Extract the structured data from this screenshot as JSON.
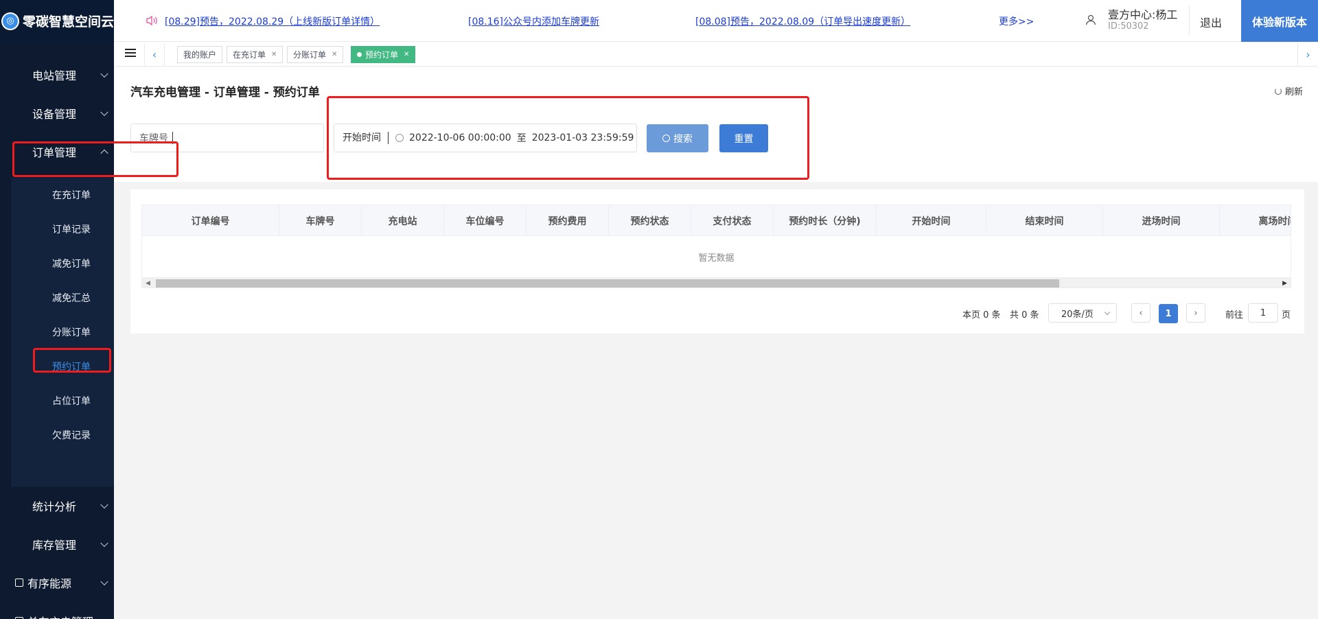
{
  "header": {
    "logo_text": "零碳智慧空间云",
    "notices": [
      "[08.29]预告，2022.08.29（上线新版订单详情）",
      "[08.16]公众号内添加车牌更新",
      "[08.08]预告，2022.08.09（订单导出速度更新）"
    ],
    "more": "更多>>",
    "user_name": "壹方中心:杨工",
    "user_id": "ID:50302",
    "logout": "退出",
    "new_version": "体验新版本"
  },
  "sidebar": {
    "items": [
      {
        "label": "电站管理"
      },
      {
        "label": "设备管理"
      },
      {
        "label": "订单管理"
      },
      {
        "label": "统计分析"
      },
      {
        "label": "库存管理"
      },
      {
        "label": "有序能源"
      },
      {
        "label": "单车充电管理"
      }
    ],
    "submenu": [
      {
        "label": "在充订单"
      },
      {
        "label": "订单记录"
      },
      {
        "label": "减免订单"
      },
      {
        "label": "减免汇总"
      },
      {
        "label": "分账订单"
      },
      {
        "label": "预约订单"
      },
      {
        "label": "占位订单"
      },
      {
        "label": "欠费记录"
      }
    ],
    "active_submenu": "预约订单"
  },
  "tabs": [
    {
      "label": "我的账户"
    },
    {
      "label": "在充订单"
    },
    {
      "label": "分账订单"
    },
    {
      "label": "预约订单"
    }
  ],
  "page": {
    "title": "汽车充电管理 - 订单管理 - 预约订单",
    "refresh": "刷新",
    "plate_placeholder": "车牌号",
    "start_time_label": "开始时间",
    "date_start": "2022-10-06 00:00:00",
    "date_sep": "至",
    "date_end": "2023-01-03 23:59:59",
    "search": "搜索",
    "reset": "重置"
  },
  "table": {
    "columns": [
      "订单编号",
      "车牌号",
      "充电站",
      "车位编号",
      "预约费用",
      "预约状态",
      "支付状态",
      "预约时长（分钟)",
      "开始时间",
      "结束时间",
      "进场时间",
      "离场时间"
    ],
    "empty_text": "暂无数据"
  },
  "pagination": {
    "page_count": "本页 0 条",
    "total": "共 0 条",
    "page_size": "20条/页",
    "current_page": "1",
    "goto_label": "前往",
    "goto_value": "1",
    "goto_suffix": "页"
  },
  "colors": {
    "sidebar_bg": "#0d1a30",
    "accent": "#3c7bd6",
    "active_tab": "#42b983",
    "highlight": "#ee1c1c"
  }
}
